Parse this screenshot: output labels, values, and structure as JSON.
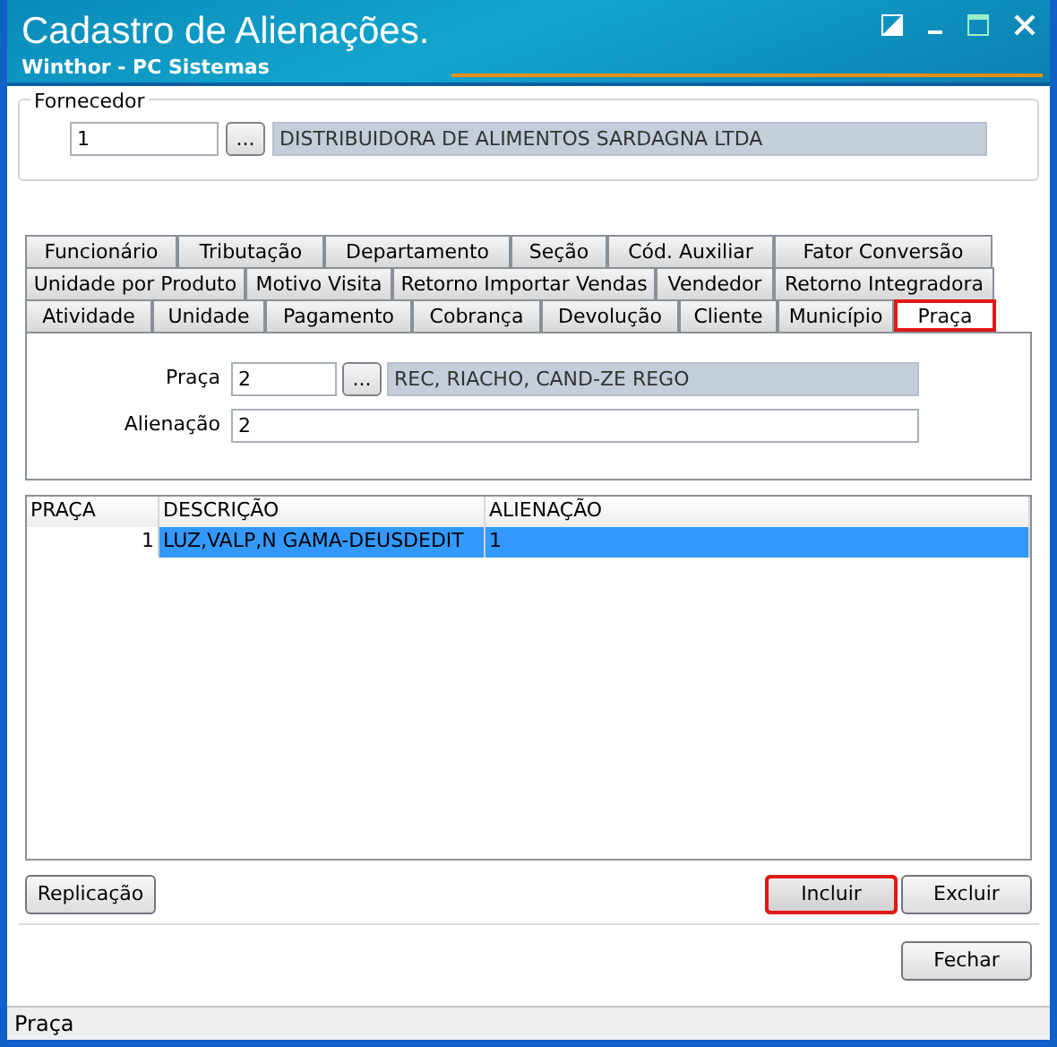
{
  "window": {
    "title": "Cadastro de Alienações.",
    "subtitle": "Winthor - PC Sistemas"
  },
  "fornecedor": {
    "legend": "Fornecedor",
    "code": "1",
    "lookup_button": "...",
    "name": "DISTRIBUIDORA DE ALIMENTOS SARDAGNA LTDA"
  },
  "tab_rows": [
    {
      "tabs": [
        {
          "label": "Funcionário",
          "selected": false,
          "highlighted": false
        },
        {
          "label": "Tributação",
          "selected": false,
          "highlighted": false
        },
        {
          "label": "Departamento",
          "selected": false,
          "highlighted": false
        },
        {
          "label": "Seção",
          "selected": false,
          "highlighted": false
        },
        {
          "label": "Cód. Auxiliar",
          "selected": false,
          "highlighted": false
        },
        {
          "label": "Fator Conversão",
          "selected": false,
          "highlighted": false
        }
      ]
    },
    {
      "tabs": [
        {
          "label": "Unidade por Produto",
          "selected": false,
          "highlighted": false
        },
        {
          "label": "Motivo Visita",
          "selected": false,
          "highlighted": false
        },
        {
          "label": "Retorno Importar Vendas",
          "selected": false,
          "highlighted": false
        },
        {
          "label": "Vendedor",
          "selected": false,
          "highlighted": false
        },
        {
          "label": "Retorno Integradora",
          "selected": false,
          "highlighted": false
        }
      ]
    },
    {
      "tabs": [
        {
          "label": "Atividade",
          "selected": false,
          "highlighted": false
        },
        {
          "label": "Unidade",
          "selected": false,
          "highlighted": false
        },
        {
          "label": "Pagamento",
          "selected": false,
          "highlighted": false
        },
        {
          "label": "Cobrança",
          "selected": false,
          "highlighted": false
        },
        {
          "label": "Devolução",
          "selected": false,
          "highlighted": false
        },
        {
          "label": "Cliente",
          "selected": false,
          "highlighted": false
        },
        {
          "label": "Município",
          "selected": false,
          "highlighted": false
        },
        {
          "label": "Praça",
          "selected": true,
          "highlighted": true
        }
      ]
    }
  ],
  "praca_form": {
    "praca_label": "Praça",
    "praca_code": "2",
    "lookup_button": "...",
    "praca_name": "REC, RIACHO, CAND-ZE REGO",
    "alienacao_label": "Alienação",
    "alienacao_value": "2"
  },
  "table": {
    "columns": [
      "PRAÇA",
      "DESCRIÇÃO",
      "ALIENAÇÃO"
    ],
    "rows": [
      {
        "cells": [
          "1",
          "LUZ,VALP,N GAMA-DEUSDEDIT",
          "1"
        ],
        "selected": true
      }
    ]
  },
  "buttons": [
    {
      "label": "Replicação",
      "highlighted": false
    },
    {
      "label": "Incluir",
      "highlighted": true
    },
    {
      "label": "Excluir",
      "highlighted": false
    }
  ],
  "close_button": {
    "label": "Fechar"
  },
  "status_bar": "Praça"
}
